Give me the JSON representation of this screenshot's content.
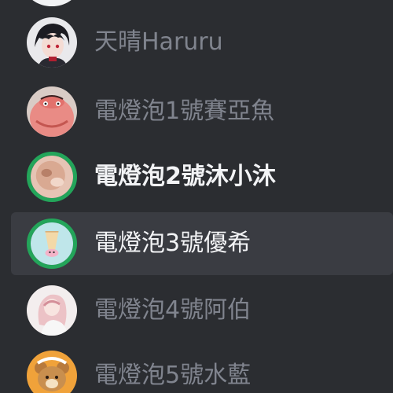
{
  "members": [
    {
      "name": "天晴Haruru",
      "avatar_icon": "anime-boy-avatar-icon"
    },
    {
      "name": "電燈泡1號賽亞魚",
      "avatar_icon": "pink-fish-avatar-icon"
    },
    {
      "name": "電燈泡2號沐小沐",
      "avatar_icon": "round-face-avatar-icon",
      "online": true
    },
    {
      "name": "電燈泡3號優希",
      "avatar_icon": "ice-cream-avatar-icon",
      "online": true
    },
    {
      "name": "電燈泡4號阿伯",
      "avatar_icon": "pink-hair-girl-avatar-icon"
    },
    {
      "name": "電燈泡5號水藍",
      "avatar_icon": "bear-avatar-icon"
    }
  ],
  "colors": {
    "background": "#2b2d31",
    "selected_row": "#3a3c42",
    "online_ring": "#23a55a",
    "muted_text": "#80848e",
    "active_text": "#f2f3f5"
  }
}
